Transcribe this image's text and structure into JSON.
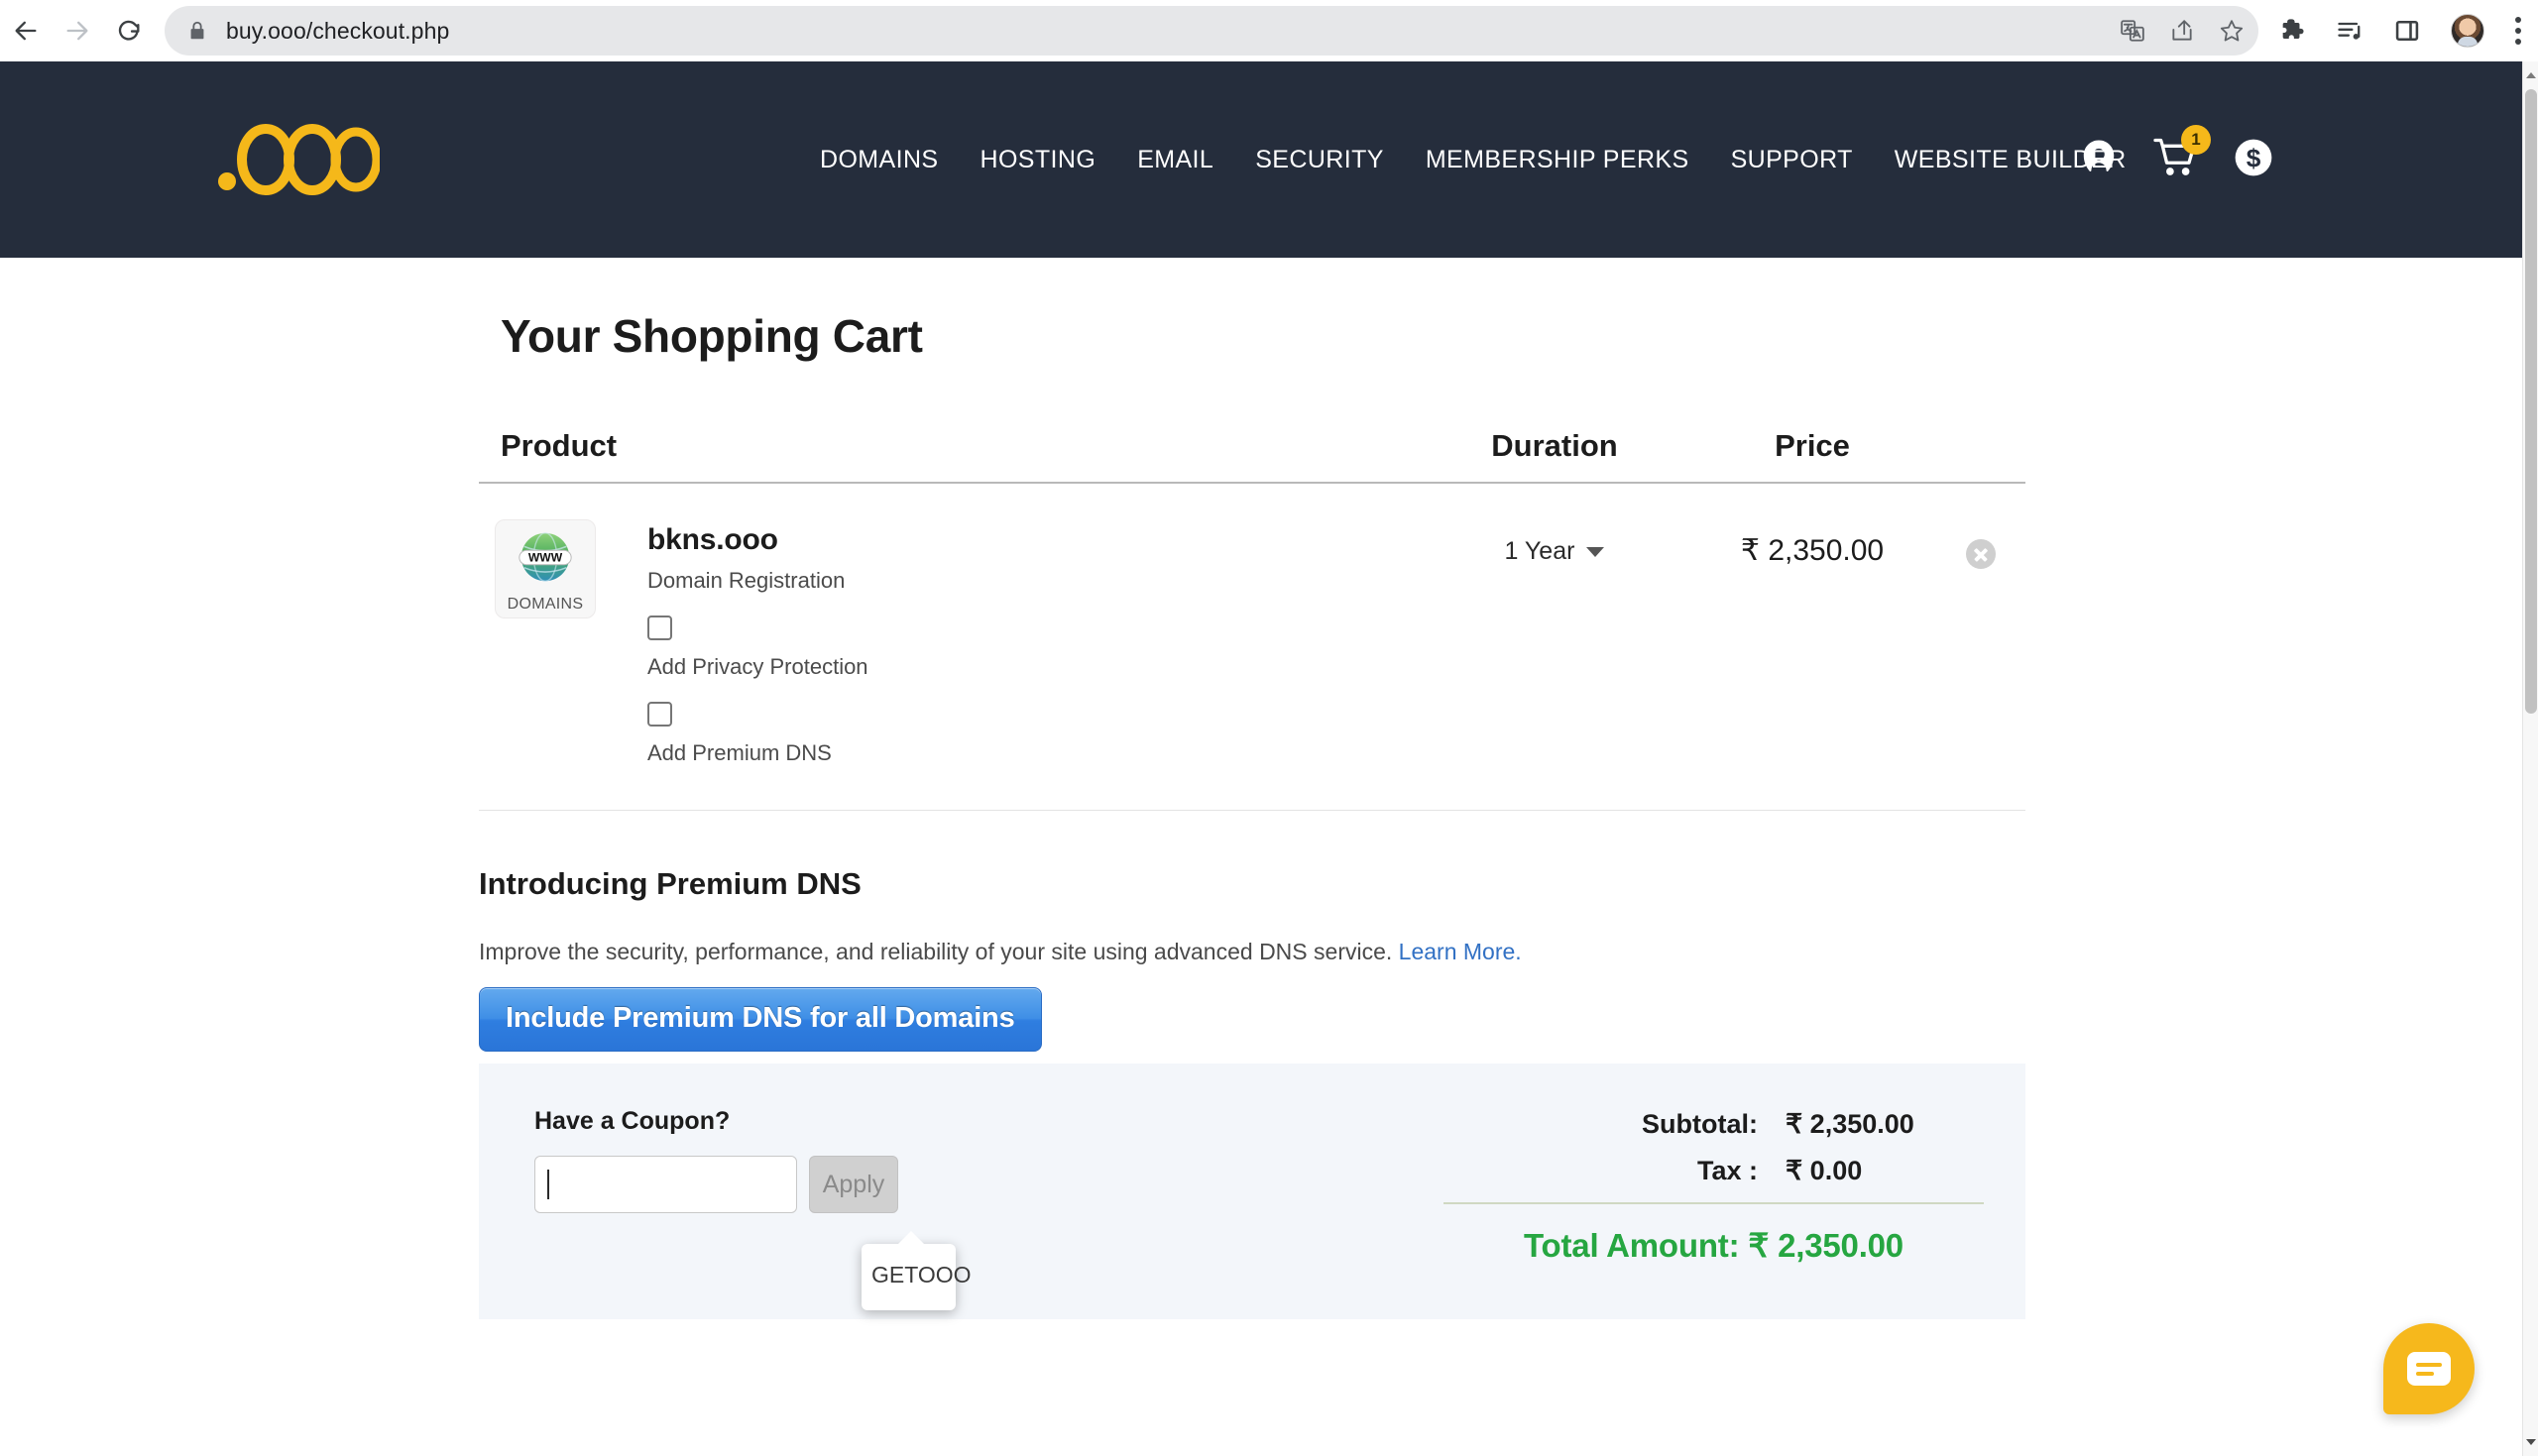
{
  "browser": {
    "url": "buy.ooo/checkout.php",
    "back_label": "Back",
    "forward_label": "Forward",
    "reload_label": "Reload",
    "icons": {
      "lock": "lock-icon",
      "translate": "translate-icon",
      "share": "share-icon",
      "bookmark": "star-icon",
      "extensions": "puzzle-icon",
      "media": "media-list-icon",
      "side_panel": "side-panel-icon",
      "profile": "avatar-icon",
      "menu": "three-dots-icon"
    }
  },
  "site": {
    "logo_text": ".OOO",
    "logo_color": "#f5b81a",
    "header_bg": "#252d3c",
    "nav": [
      {
        "label": "DOMAINS"
      },
      {
        "label": "HOSTING"
      },
      {
        "label": "EMAIL"
      },
      {
        "label": "SECURITY"
      },
      {
        "label": "MEMBERSHIP PERKS"
      },
      {
        "label": "SUPPORT"
      },
      {
        "label": "WEBSITE BUILDER"
      }
    ],
    "header_icons": {
      "account": "user-icon",
      "cart": "cart-icon",
      "cart_badge": "1",
      "currency": "dollar-circle-icon"
    }
  },
  "page": {
    "title": "Your Shopping Cart"
  },
  "cart": {
    "columns": {
      "product": "Product",
      "duration": "Duration",
      "price": "Price"
    },
    "items": [
      {
        "thumb_label": "DOMAINS",
        "thumb_icon": "globe-www-icon",
        "name": "bkns.ooo",
        "subtitle": "Domain Registration",
        "addons": [
          {
            "label": "Add Privacy Protection",
            "checked": false
          },
          {
            "label": "Add Premium DNS",
            "checked": false
          }
        ],
        "duration": "1 Year",
        "price": "₹ 2,350.00",
        "remove_label": "Remove item"
      }
    ]
  },
  "premium_dns": {
    "title": "Introducing Premium DNS",
    "description": "Improve the security, performance, and reliability of your site using advanced DNS service.",
    "learn_more": "Learn More.",
    "button_label": "Include Premium DNS for all Domains",
    "button_color": "#2f7ee0"
  },
  "coupon": {
    "label": "Have a Coupon?",
    "input_value": "",
    "placeholder": "",
    "apply_label": "Apply",
    "suggestion": "GETOOO"
  },
  "summary": {
    "subtotal_label": "Subtotal:",
    "subtotal_value": "₹ 2,350.00",
    "tax_label": "Tax :",
    "tax_value": "₹ 0.00",
    "total_text": "Total Amount: ₹ 2,350.00",
    "total_color": "#26a641"
  },
  "chat": {
    "icon": "chat-bubble-icon",
    "color": "#f6b81c"
  }
}
